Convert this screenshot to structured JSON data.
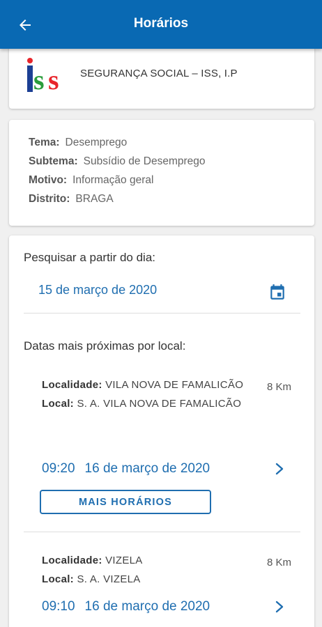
{
  "appbar": {
    "title": "Horários",
    "back_icon": "arrow-left-icon",
    "color": "#0969b3"
  },
  "entity": {
    "logo_text": "iss",
    "name": "SEGURANÇA SOCIAL – ISS, I.P"
  },
  "details": [
    {
      "label": "Tema:",
      "value": "Desemprego"
    },
    {
      "label": "Subtema:",
      "value": "Subsídio de Desemprego"
    },
    {
      "label": "Motivo:",
      "value": "Informação geral"
    },
    {
      "label": "Distrito:",
      "value": "BRAGA"
    }
  ],
  "search": {
    "label": "Pesquisar a partir do dia:",
    "date": "15 de março de 2020",
    "icon": "calendar-icon"
  },
  "nearest": {
    "label": "Datas mais próximas por local:",
    "locations": [
      {
        "localidade_label": "Localidade:",
        "localidade": "VILA NOVA DE FAMALICÃO",
        "local_label": "Local:",
        "local": "S. A. VILA NOVA DE FAMALICÃO",
        "distance": "8 Km",
        "time": "09:20",
        "date": "16 de março de 2020",
        "more_label": "MAIS HORÁRIOS"
      },
      {
        "localidade_label": "Localidade:",
        "localidade": "VIZELA",
        "local_label": "Local:",
        "local": "S. A. VIZELA",
        "distance": "8 Km",
        "time": "09:10",
        "date": "16 de março de 2020"
      }
    ]
  },
  "colors": {
    "primary": "#0969b3",
    "link": "#1f6eb0"
  }
}
